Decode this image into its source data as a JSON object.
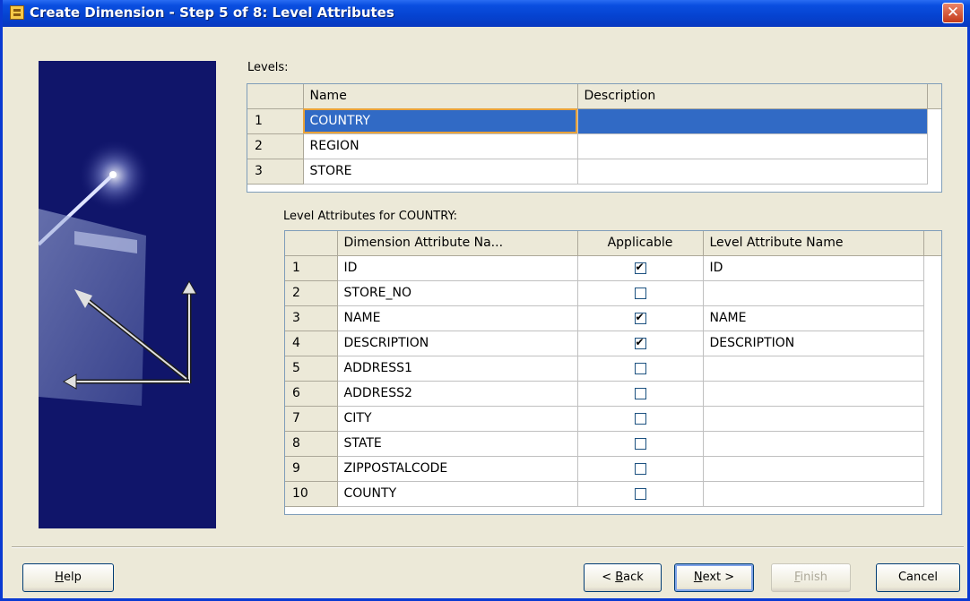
{
  "window": {
    "title": "Create Dimension - Step 5 of 8: Level Attributes",
    "close_glyph": "✕"
  },
  "levels": {
    "label": "Levels:",
    "columns": [
      "Name",
      "Description"
    ],
    "rows": [
      {
        "num": "1",
        "name": "COUNTRY",
        "description": ""
      },
      {
        "num": "2",
        "name": "REGION",
        "description": ""
      },
      {
        "num": "3",
        "name": "STORE",
        "description": ""
      }
    ],
    "selected_row": 0
  },
  "attributes": {
    "label": "Level Attributes for COUNTRY:",
    "columns": [
      "Dimension Attribute Na...",
      "Applicable",
      "Level Attribute Name"
    ],
    "rows": [
      {
        "num": "1",
        "dim_attr": "ID",
        "applicable": true,
        "level_attr": "ID"
      },
      {
        "num": "2",
        "dim_attr": "STORE_NO",
        "applicable": false,
        "level_attr": ""
      },
      {
        "num": "3",
        "dim_attr": "NAME",
        "applicable": true,
        "level_attr": "NAME"
      },
      {
        "num": "4",
        "dim_attr": "DESCRIPTION",
        "applicable": true,
        "level_attr": "DESCRIPTION"
      },
      {
        "num": "5",
        "dim_attr": "ADDRESS1",
        "applicable": false,
        "level_attr": ""
      },
      {
        "num": "6",
        "dim_attr": "ADDRESS2",
        "applicable": false,
        "level_attr": ""
      },
      {
        "num": "7",
        "dim_attr": "CITY",
        "applicable": false,
        "level_attr": ""
      },
      {
        "num": "8",
        "dim_attr": "STATE",
        "applicable": false,
        "level_attr": ""
      },
      {
        "num": "9",
        "dim_attr": "ZIPPOSTALCODE",
        "applicable": false,
        "level_attr": ""
      },
      {
        "num": "10",
        "dim_attr": "COUNTY",
        "applicable": false,
        "level_attr": ""
      }
    ]
  },
  "buttons": {
    "help": {
      "mnemonic": "H",
      "rest": "elp"
    },
    "back": {
      "prefix": "< ",
      "mnemonic": "B",
      "rest": "ack"
    },
    "next": {
      "mnemonic": "N",
      "rest": "ext >"
    },
    "finish": {
      "mnemonic": "F",
      "rest": "inish"
    },
    "cancel": {
      "label": "Cancel"
    }
  },
  "colors": {
    "title_bar": "#0543d0",
    "selection": "#316ac5",
    "focus_border": "#e8a23a",
    "banner": "#0f1468"
  }
}
